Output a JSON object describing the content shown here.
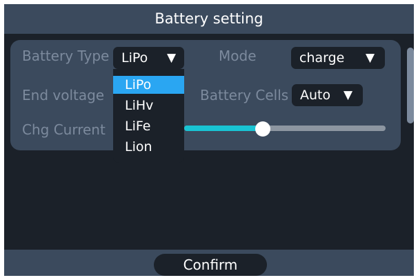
{
  "title": "Battery setting",
  "fields": {
    "battery_type": {
      "label": "Battery Type",
      "value": "LiPo"
    },
    "mode": {
      "label": "Mode",
      "value": "charge"
    },
    "end_voltage": {
      "label": "End voltage"
    },
    "battery_cells": {
      "label": "Battery Cells",
      "value": "Auto"
    },
    "chg_current": {
      "label": "Chg Current",
      "level": 0.39
    }
  },
  "dropdown_arrow": "▼",
  "battery_type_menu": {
    "options": [
      "LiPo",
      "LiHv",
      "LiFe",
      "Lion"
    ],
    "selected": "LiPo"
  },
  "confirm_label": "Confirm",
  "colors": {
    "background": "#1b2129",
    "panel": "#3b4a5d",
    "label": "#7c8a9d",
    "selection": "#2aa6f2",
    "slider_fill": "#19c4d4",
    "slider_track": "#8d96a1"
  }
}
